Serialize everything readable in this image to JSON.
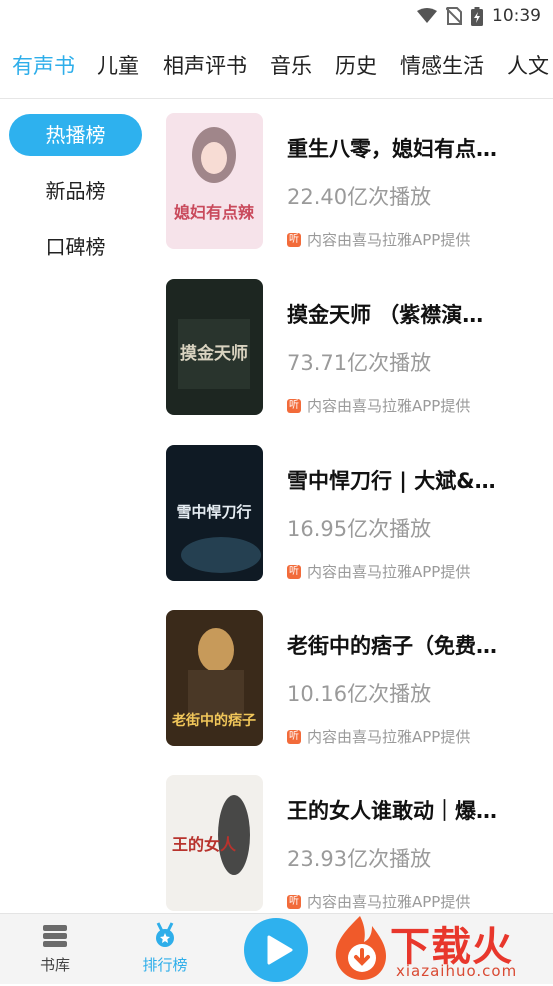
{
  "status_bar": {
    "time": "10:39"
  },
  "category_tabs": [
    {
      "label": "有声书",
      "active": true
    },
    {
      "label": "儿童"
    },
    {
      "label": "相声评书"
    },
    {
      "label": "音乐"
    },
    {
      "label": "历史"
    },
    {
      "label": "情感生活"
    },
    {
      "label": "人文"
    }
  ],
  "sidebar": {
    "items": [
      {
        "label": "热播榜",
        "active": true
      },
      {
        "label": "新品榜"
      },
      {
        "label": "口碑榜"
      }
    ]
  },
  "books": [
    {
      "title": "重生八零，媳妇有点…",
      "plays": "22.40亿次播放",
      "source": "内容由喜马拉雅APP提供",
      "cover_text": "媳妇有点辣",
      "cover_colors": [
        "#f6e3ea",
        "#c94a5c"
      ]
    },
    {
      "title": "摸金天师 （紫襟演…",
      "plays": "73.71亿次播放",
      "source": "内容由喜马拉雅APP提供",
      "cover_text": "摸金天师",
      "cover_colors": [
        "#1d2621",
        "#d9d3c0"
      ]
    },
    {
      "title": "雪中悍刀行 | 大斌&…",
      "plays": "16.95亿次播放",
      "source": "内容由喜马拉雅APP提供",
      "cover_text": "雪中悍刀行",
      "cover_colors": [
        "#0f1a24",
        "#e6edf3"
      ]
    },
    {
      "title": "老街中的痞子（免费…",
      "plays": "10.16亿次播放",
      "source": "内容由喜马拉雅APP提供",
      "cover_text": "老街中的痞子",
      "cover_colors": [
        "#3a2a1a",
        "#f0c65a"
      ]
    },
    {
      "title": "王的女人谁敢动｜爆…",
      "plays": "23.93亿次播放",
      "source": "内容由喜马拉雅APP提供",
      "cover_text": "王的女人",
      "cover_colors": [
        "#f2f0ec",
        "#b8332d"
      ]
    }
  ],
  "bottom_nav": {
    "items": [
      {
        "label": "书库",
        "icon": "library-stack-icon"
      },
      {
        "label": "排行榜",
        "icon": "ranking-medal-icon",
        "active": true
      }
    ],
    "play_icon": "play-icon"
  },
  "watermark": {
    "brand": "下载火",
    "url": "xiazaihuo.com"
  },
  "colors": {
    "accent": "#2eb1ee",
    "source_badge": "#f26b3a",
    "watermark": "#e8372c"
  }
}
